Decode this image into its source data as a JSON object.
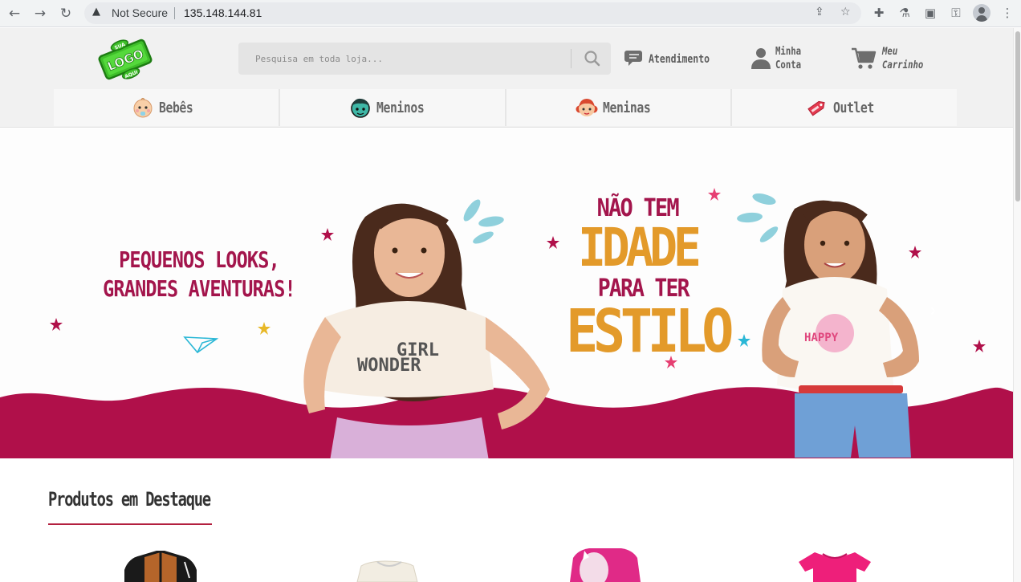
{
  "browser": {
    "security_label": "Not Secure",
    "url": "135.148.144.81"
  },
  "header": {
    "logo_text": {
      "top": "SUA",
      "middle": "LOGO",
      "bottom": "AQUI"
    },
    "search": {
      "placeholder": "Pesquisa em toda loja..."
    },
    "atendimento": "Atendimento",
    "conta": {
      "line1": "Minha",
      "line2": "Conta"
    },
    "carrinho": {
      "line1": "Meu",
      "line2": "Carrinho"
    }
  },
  "categories": [
    {
      "label": "Bebês",
      "icon": "baby-face-icon"
    },
    {
      "label": "Meninos",
      "icon": "boy-face-icon"
    },
    {
      "label": "Meninas",
      "icon": "girl-face-icon"
    },
    {
      "label": "Outlet",
      "icon": "tag-icon"
    }
  ],
  "banner": {
    "left_line1": "PEQUENOS LOOKS,",
    "left_line2": "GRANDES AVENTURAS!",
    "right_line1": "NÃO TEM",
    "right_line2": "IDADE",
    "right_line3": "PARA TER",
    "right_line4": "ESTILO",
    "shirt_left": {
      "line1": "GIRL",
      "line2": "WONDER"
    },
    "shirt_right": "HAPPY",
    "colors": {
      "wave": "#b0104a",
      "headline": "#a3154c",
      "accent": "#e39a2a"
    }
  },
  "featured": {
    "title": "Produtos em Destaque"
  }
}
